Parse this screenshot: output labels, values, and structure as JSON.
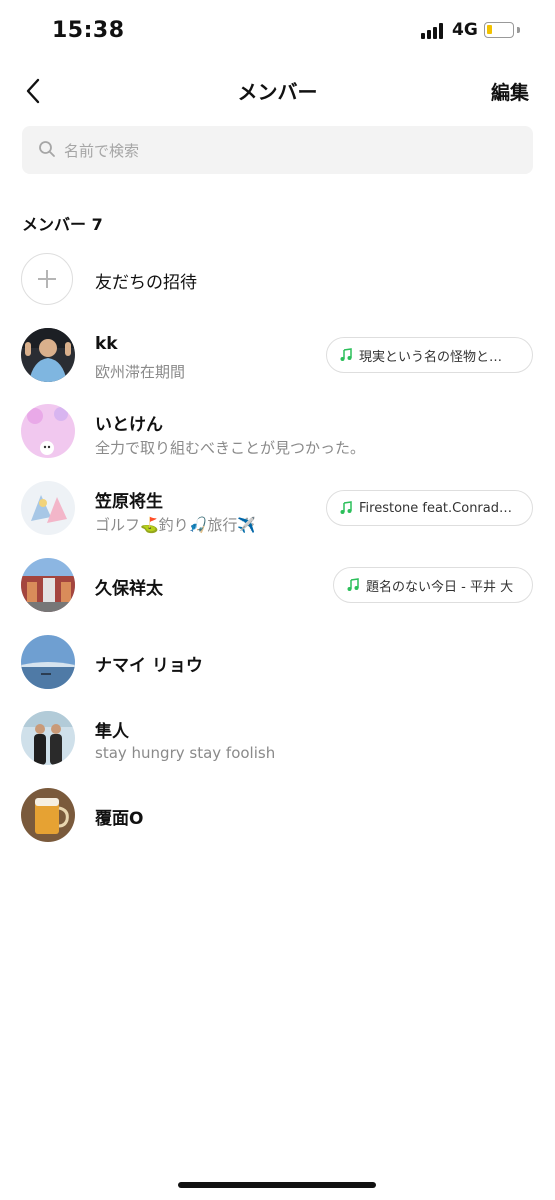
{
  "status_bar": {
    "time": "15:38",
    "network": "4G",
    "battery_level": 0.2
  },
  "nav": {
    "title": "メンバー",
    "edit_label": "編集"
  },
  "search": {
    "placeholder": "名前で検索"
  },
  "section_header": "メンバー 7",
  "invite": {
    "label": "友だちの招待"
  },
  "members": [
    {
      "name": "kk",
      "status": "欧州滞在期間",
      "music": "現実という名の怪物と…"
    },
    {
      "name": "いとけん",
      "status": "全力で取り組むべきことが見つかった。"
    },
    {
      "name": "笠原将生",
      "status": "ゴルフ⛳️釣り🎣旅行✈️",
      "music": "Firestone feat.Conrad…"
    },
    {
      "name": "久保祥太",
      "music": "題名のない今日 - 平井 大"
    },
    {
      "name": "ナマイ リョウ"
    },
    {
      "name": "隼人",
      "status": "stay hungry stay foolish"
    },
    {
      "name": "覆面O"
    }
  ],
  "colors": {
    "music_note": "#2bbf5a",
    "battery_fill": "#f2c200",
    "search_bg": "#f3f3f3"
  }
}
